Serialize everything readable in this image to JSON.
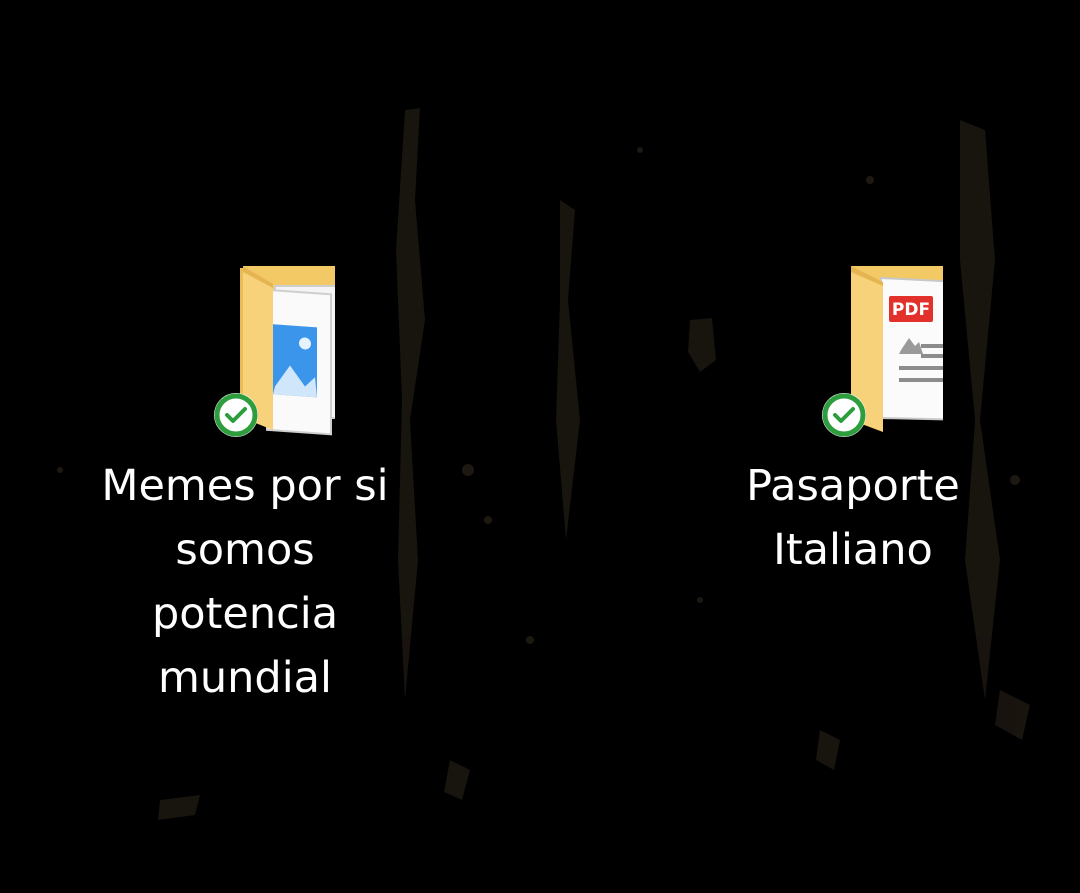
{
  "desktop": {
    "icons": [
      {
        "name": "Memes por si somos potencia mundial",
        "lines": [
          "Memes por si",
          "somos",
          "potencia",
          "mundial"
        ],
        "icon": "folder-pictures-icon",
        "status": "sync-ok-icon"
      },
      {
        "name": "Pasaporte Italiano",
        "lines": [
          "Pasaporte",
          "Italiano"
        ],
        "icon": "folder-pdf-icon",
        "status": "sync-ok-icon",
        "badge_text": "PDF"
      }
    ]
  },
  "colors": {
    "background": "#000000",
    "folder": "#f5cc6b",
    "folder_dark": "#dcae47",
    "sync_green": "#2e9d3e",
    "pdf_red": "#e2312b",
    "label_text": "#ffffff"
  }
}
